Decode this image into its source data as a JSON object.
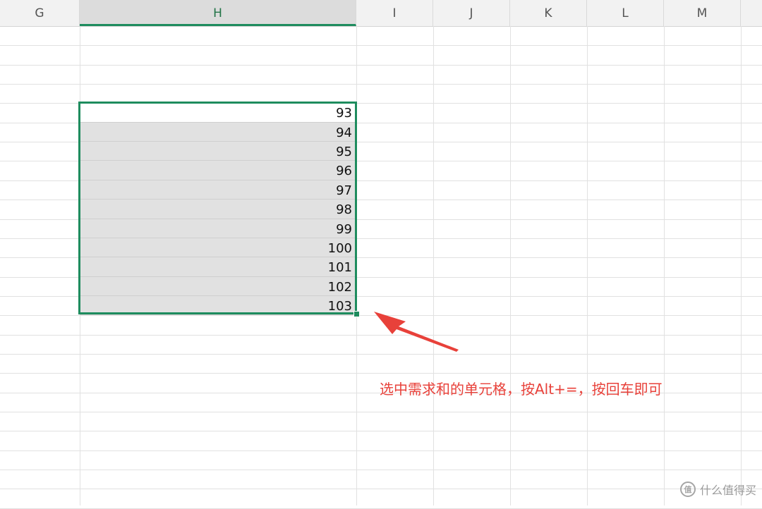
{
  "sheet": {
    "columns": [
      {
        "label": "G",
        "active": false
      },
      {
        "label": "H",
        "active": true
      },
      {
        "label": "I",
        "active": false
      },
      {
        "label": "J",
        "active": false
      },
      {
        "label": "K",
        "active": false
      },
      {
        "label": "L",
        "active": false
      },
      {
        "label": "M",
        "active": false
      }
    ],
    "selected_column": "H",
    "values": [
      "93",
      "94",
      "95",
      "96",
      "97",
      "98",
      "99",
      "100",
      "101",
      "102",
      "103"
    ]
  },
  "annotation": {
    "text": "选中需求和的单元格，按Alt+=，按回车即可",
    "color": "#e8413a"
  },
  "watermark": {
    "logo_text": "值",
    "text": "什么值得买"
  },
  "colors": {
    "selection_border": "#1e8c5e",
    "selection_fill": "#e1e1e1",
    "arrow": "#e8413a"
  }
}
